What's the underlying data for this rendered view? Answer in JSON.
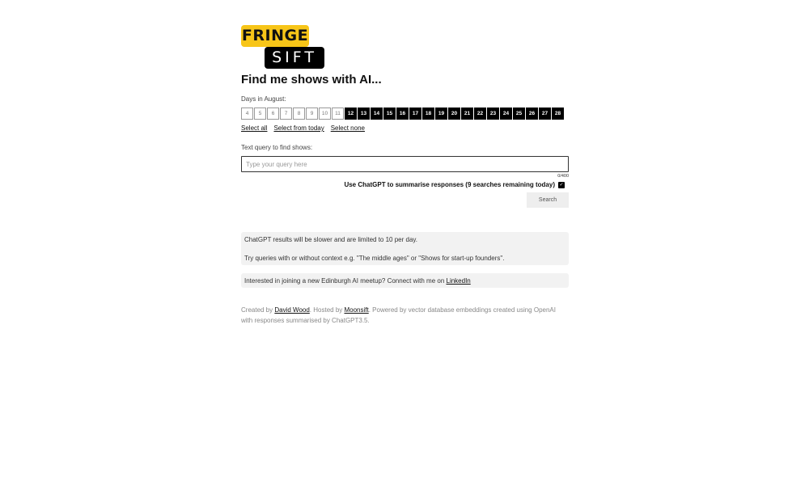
{
  "logo": {
    "top": "FRINGE",
    "bottom": "SIFT",
    "top_color": "#f7c518",
    "bottom_color": "#000000"
  },
  "page_title": "Find me shows with AI...",
  "days": {
    "label": "Days in August:",
    "items": [
      {
        "label": "4",
        "selected": false
      },
      {
        "label": "5",
        "selected": false
      },
      {
        "label": "6",
        "selected": false
      },
      {
        "label": "7",
        "selected": false
      },
      {
        "label": "8",
        "selected": false
      },
      {
        "label": "9",
        "selected": false
      },
      {
        "label": "10",
        "selected": false
      },
      {
        "label": "11",
        "selected": false
      },
      {
        "label": "12",
        "selected": true
      },
      {
        "label": "13",
        "selected": true
      },
      {
        "label": "14",
        "selected": true
      },
      {
        "label": "15",
        "selected": true
      },
      {
        "label": "16",
        "selected": true
      },
      {
        "label": "17",
        "selected": true
      },
      {
        "label": "18",
        "selected": true
      },
      {
        "label": "19",
        "selected": true
      },
      {
        "label": "20",
        "selected": true
      },
      {
        "label": "21",
        "selected": true
      },
      {
        "label": "22",
        "selected": true
      },
      {
        "label": "23",
        "selected": true
      },
      {
        "label": "24",
        "selected": true
      },
      {
        "label": "25",
        "selected": true
      },
      {
        "label": "26",
        "selected": true
      },
      {
        "label": "27",
        "selected": true
      },
      {
        "label": "28",
        "selected": true
      }
    ],
    "select_all": "Select all",
    "select_from_today": "Select from today",
    "select_none": "Select none"
  },
  "query": {
    "label": "Text query to find shows:",
    "placeholder": "Type your query here",
    "value": "",
    "counter": "0/400"
  },
  "summarise": {
    "label": "Use ChatGPT to summarise responses (9 searches remaining today)",
    "checked": true,
    "check_glyph": "✓"
  },
  "search_button": "Search",
  "info": {
    "line1": "ChatGPT results will be slower and are limited to 10 per day.",
    "line2": "Try queries with or without context e.g. \"The middle ages\" or \"Shows for start-up founders\"."
  },
  "meetup": {
    "text": "Interested in joining a new Edinburgh AI meetup? Connect with me on ",
    "link": "LinkedIn"
  },
  "footer": {
    "created_by": "Created by ",
    "author": "David Wood",
    "hosted_by": ". Hosted by ",
    "host": "Moonsift",
    "rest": ". Powered by vector database embeddings created using OpenAI with responses summarised by ChatGPT3.5."
  }
}
